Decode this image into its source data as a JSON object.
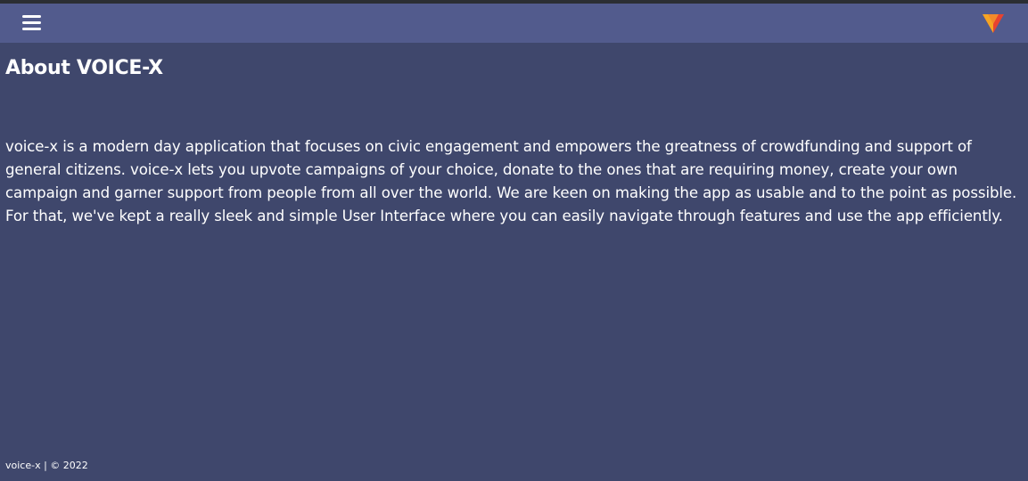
{
  "header": {
    "menu_icon": "hamburger-menu-icon",
    "logo_icon": "voice-x-logo-icon",
    "accent_colors": [
      "#f5a524",
      "#e8432f",
      "#e86a2a"
    ],
    "navbar_color": "#525b8d",
    "background_color": "#3f476c"
  },
  "main": {
    "title": "About VOICE-X",
    "description": "voice-x is a modern day application that focuses on civic engagement and empowers the greatness of crowdfunding and support of general citizens. voice-x lets you upvote campaigns of your choice, donate to the ones that are requiring money, create your own campaign and garner support from people from all over the world. We are keen on making the app as usable and to the point as possible. For that, we've kept a really sleek and simple User Interface where you can easily navigate through features and use the app efficiently."
  },
  "footer": {
    "text": "voice-x | © 2022"
  }
}
